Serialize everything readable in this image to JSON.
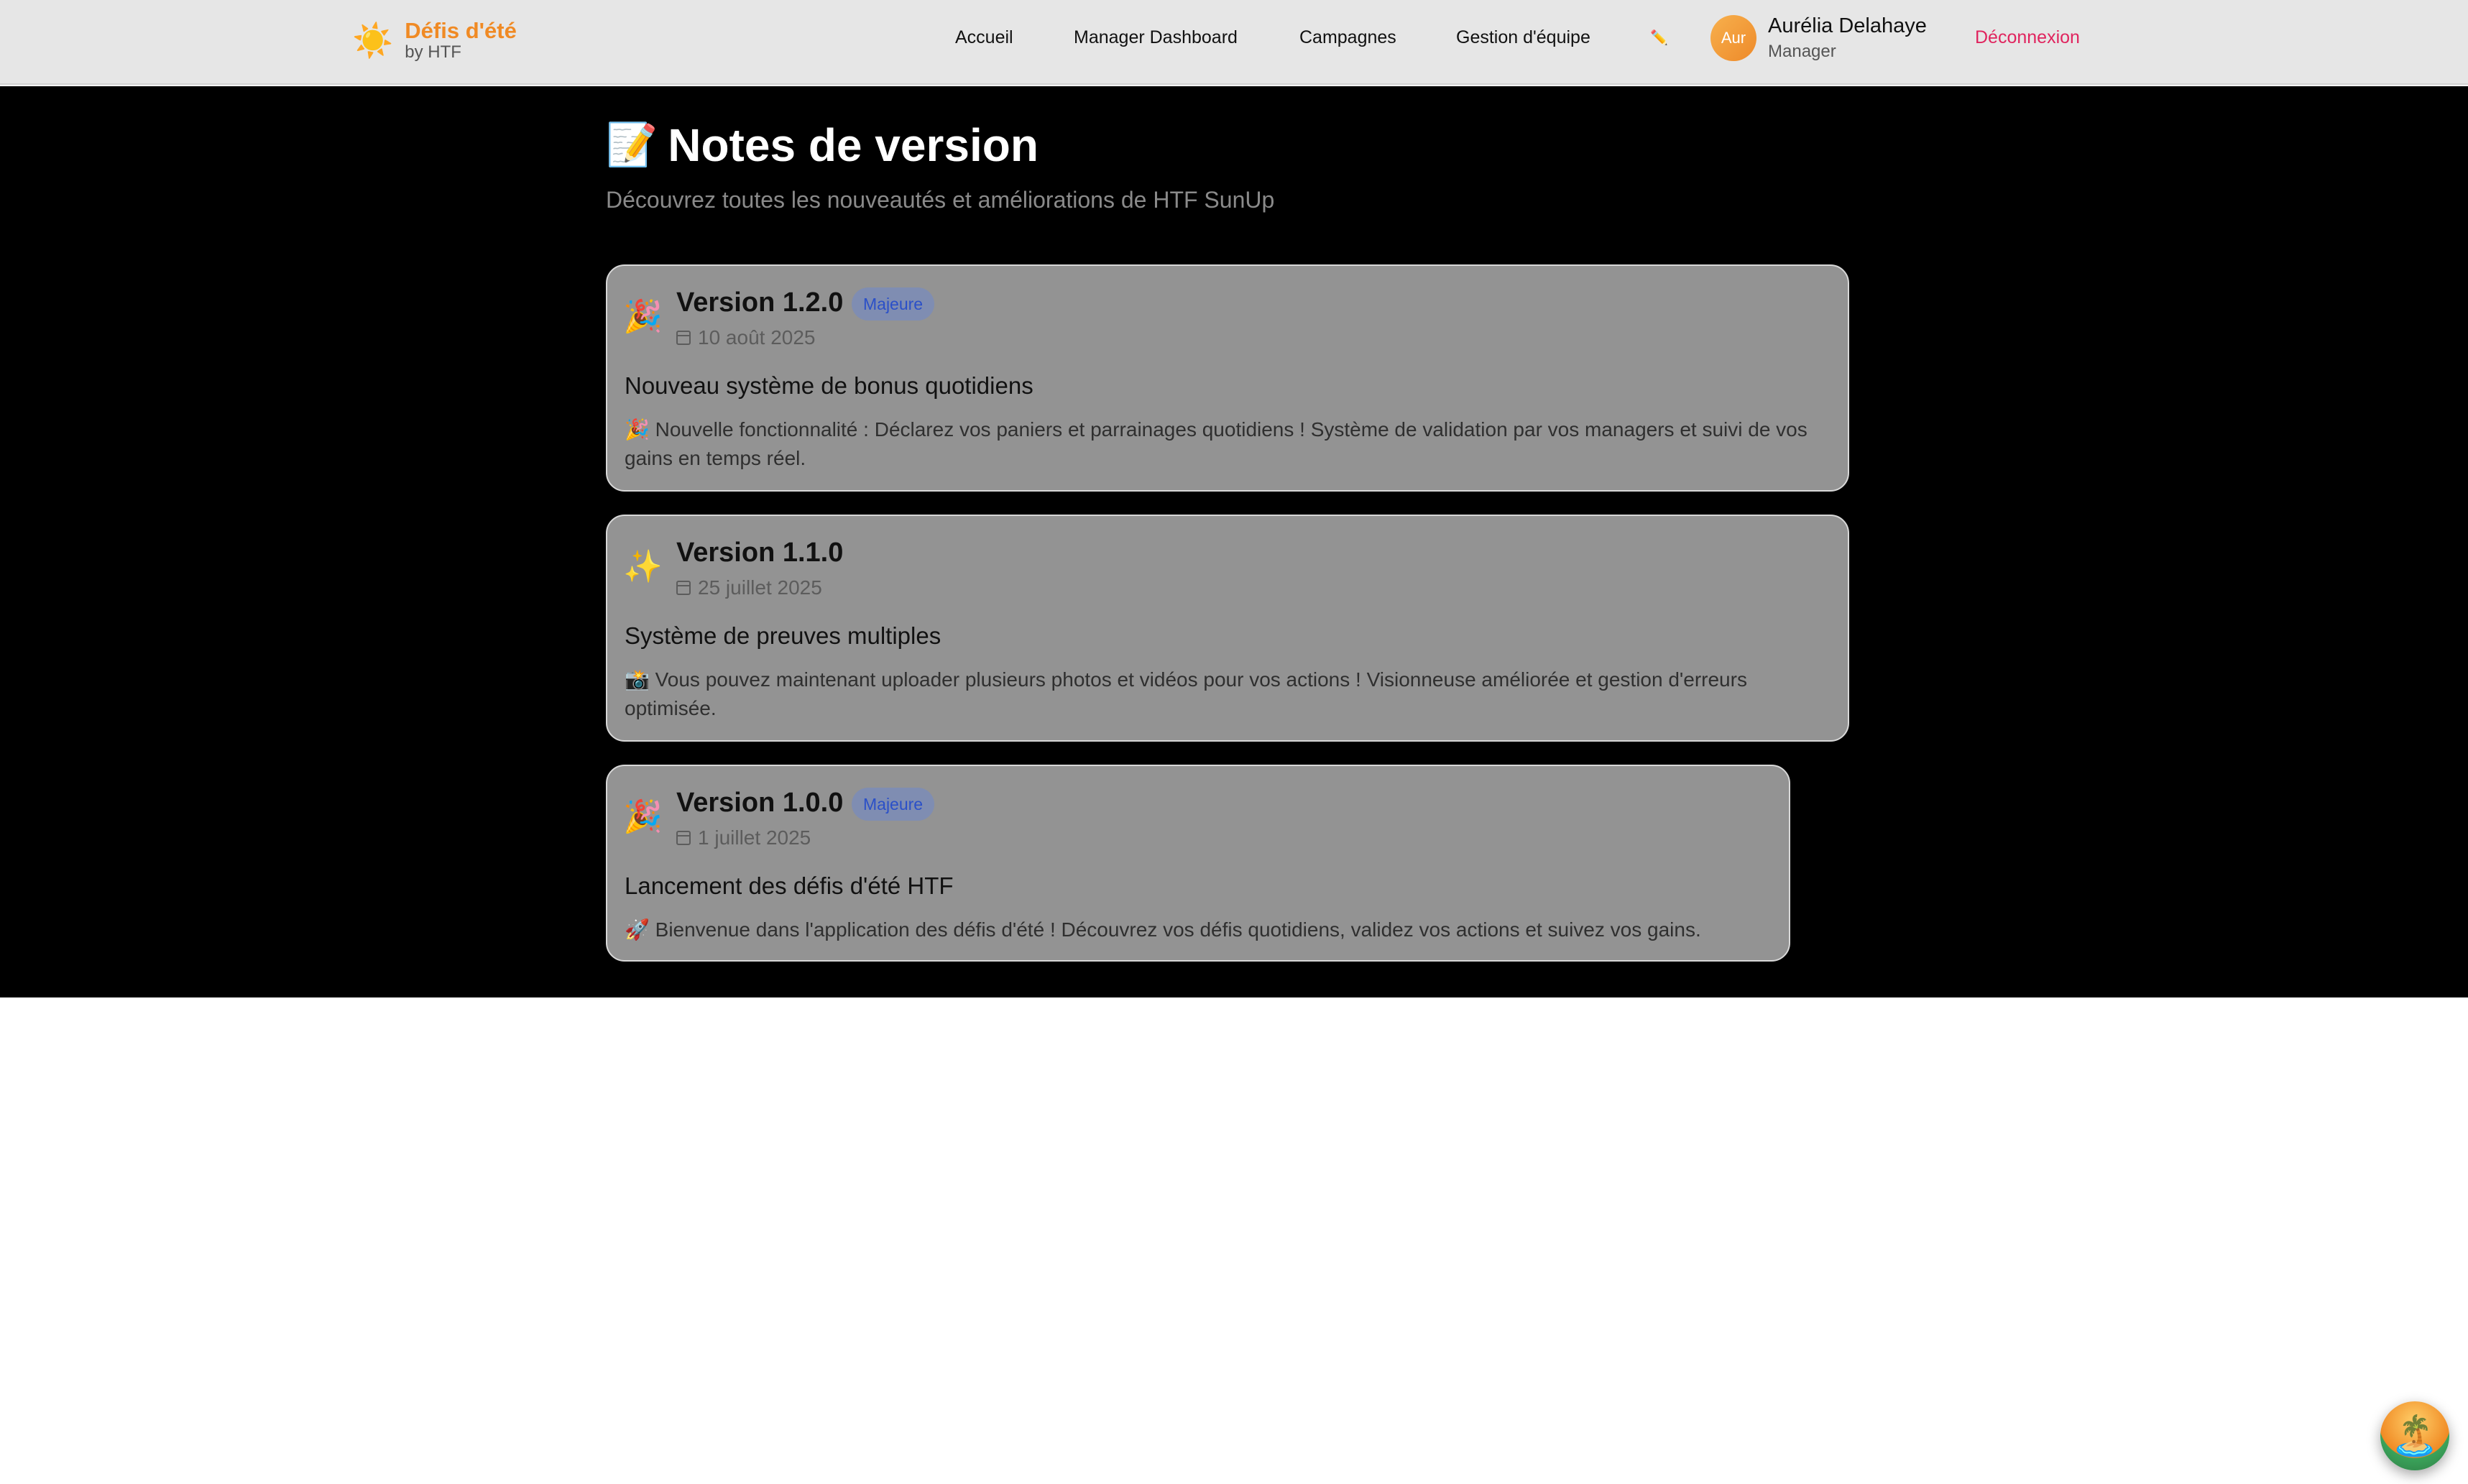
{
  "header": {
    "brand_icon": "sun-icon",
    "brand_title": "Défis d'été",
    "brand_sub": "by HTF",
    "nav": [
      "Accueil",
      "Manager Dashboard",
      "Campagnes",
      "Gestion d'équipe"
    ],
    "release_notes_icon": "pencil-icon",
    "avatar_text": "Aur",
    "user_name": "Aurélia Delahaye",
    "user_role": "Manager",
    "logout": "Déconnexion"
  },
  "page": {
    "title_emoji": "📝",
    "title": "Notes de version",
    "subtitle": "Découvrez toutes les nouveautés et améliorations de HTF SunUp"
  },
  "releases": [
    {
      "emoji": "🎉",
      "version": "Version 1.2.0",
      "badge": "Majeure",
      "date": "10 août 2025",
      "title": "Nouveau système de bonus quotidiens",
      "description": "🎉 Nouvelle fonctionnalité : Déclarez vos paniers et parrainages quotidiens ! Système de validation par vos managers et suivi de vos gains en temps réel."
    },
    {
      "emoji": "✨",
      "version": "Version 1.1.0",
      "badge": "",
      "date": "25 juillet 2025",
      "title": "Système de preuves multiples",
      "description": "📸 Vous pouvez maintenant uploader plusieurs photos et vidéos pour vos actions ! Visionneuse améliorée et gestion d'erreurs optimisée."
    },
    {
      "emoji": "🎉",
      "version": "Version 1.0.0",
      "badge": "Majeure",
      "date": "1 juillet 2025",
      "title": "Lancement des défis d'été HTF",
      "description": "🚀 Bienvenue dans l'application des défis d'été ! Découvrez vos défis quotidiens, validez vos actions et suivez vos gains."
    }
  ],
  "floating_button_icon": "beach-icon",
  "colors": {
    "brand": "#f08a24",
    "logout": "#e0245e",
    "badge_text": "#2b50c8"
  }
}
